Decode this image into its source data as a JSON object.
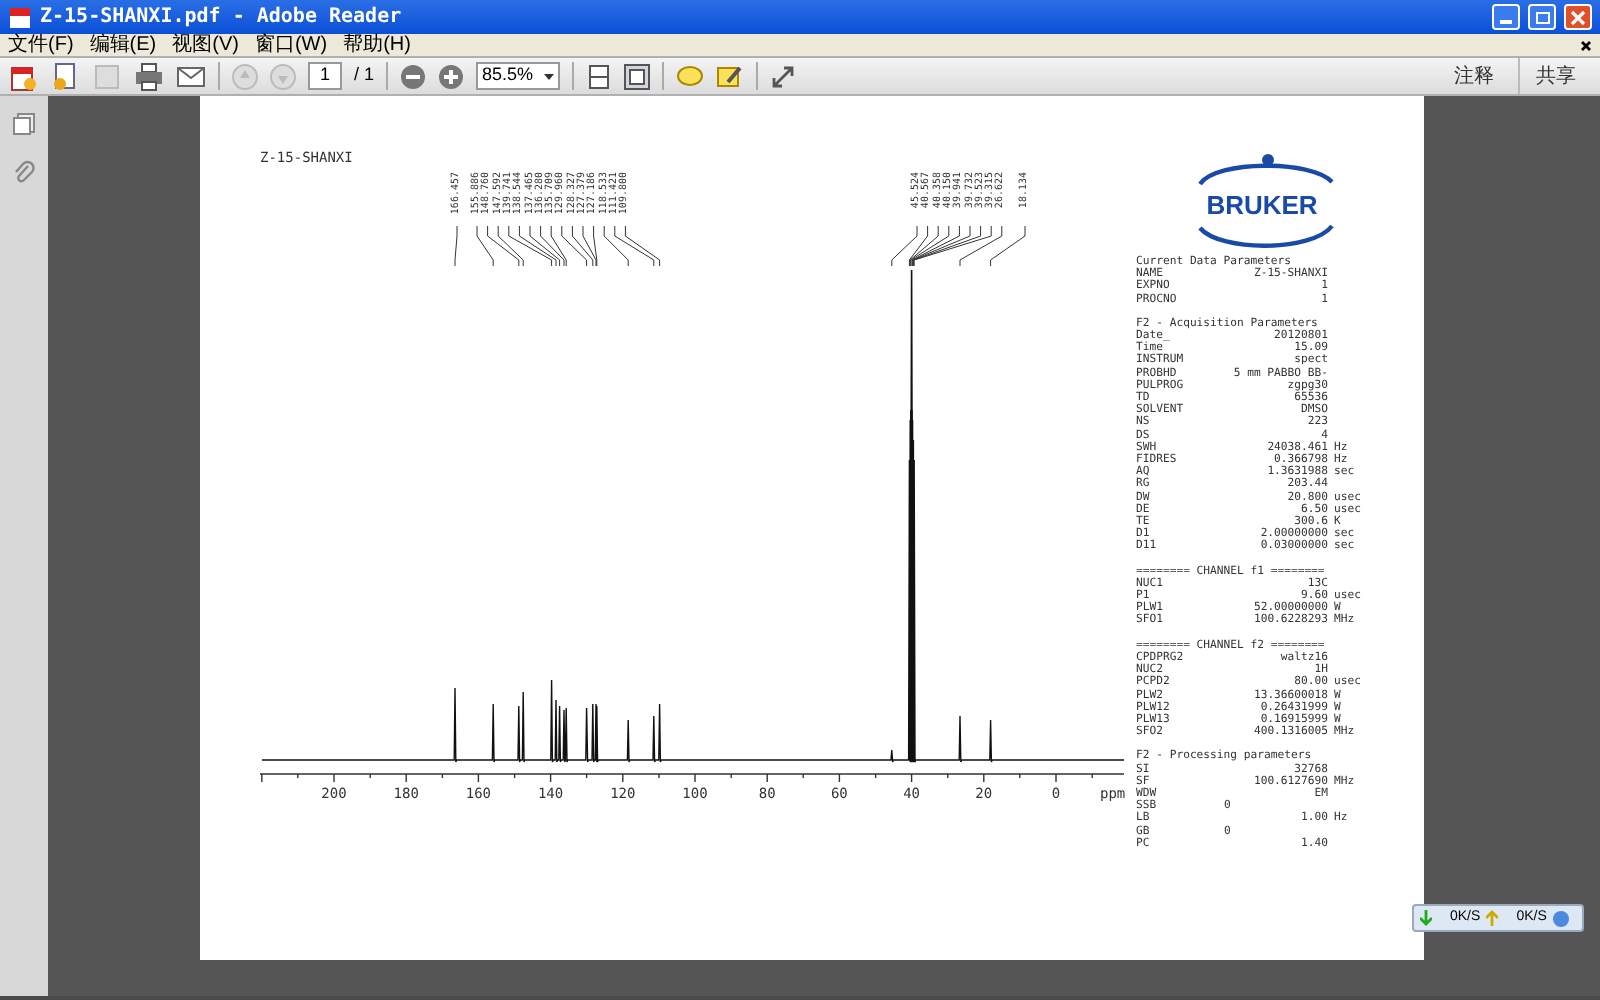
{
  "window": {
    "title": "Z-15-SHANXI.pdf - Adobe Reader"
  },
  "menu": [
    "文件(F)",
    "编辑(E)",
    "视图(V)",
    "窗口(W)",
    "帮助(H)"
  ],
  "toolbar": {
    "page": "1",
    "page_count": "/ 1",
    "zoom": "85.5%",
    "buttons": [
      "注释",
      "共享"
    ]
  },
  "document": {
    "title": "Z-15-SHANXI",
    "peak_labels": [
      "166.457",
      "155.886",
      "148.760",
      "147.592",
      "139.741",
      "138.544",
      "137.465",
      "136.280",
      "135.709",
      "129.960",
      "128.327",
      "127.379",
      "127.186",
      "118.533",
      "111.421",
      "109.800",
      "45.524",
      "40.567",
      "40.358",
      "40.150",
      "39.941",
      "39.732",
      "39.523",
      "39.315",
      "26.622",
      "18.134"
    ],
    "axis": {
      "ticks": [
        "200",
        "180",
        "160",
        "140",
        "120",
        "100",
        "80",
        "60",
        "40",
        "20",
        "0"
      ],
      "unit": "ppm"
    },
    "logo": "BRUKER",
    "parameters": [
      {
        "heading": "Current Data Parameters",
        "rows": [
          {
            "name": "NAME",
            "value": "Z-15-SHANXI"
          },
          {
            "name": "EXPNO",
            "value": "1"
          },
          {
            "name": "PROCNO",
            "value": "1"
          }
        ]
      },
      {
        "heading": "F2 - Acquisition Parameters",
        "rows": [
          {
            "name": "Date_",
            "value": "20120801"
          },
          {
            "name": "Time",
            "value": "15.09"
          },
          {
            "name": "INSTRUM",
            "value": "spect"
          },
          {
            "name": "PROBHD",
            "value": "5 mm PABBO BB-"
          },
          {
            "name": "PULPROG",
            "value": "zgpg30"
          },
          {
            "name": "TD",
            "value": "65536"
          },
          {
            "name": "SOLVENT",
            "value": "DMSO"
          },
          {
            "name": "NS",
            "value": "223"
          },
          {
            "name": "DS",
            "value": "4"
          },
          {
            "name": "SWH",
            "value": "24038.461",
            "unit": "Hz"
          },
          {
            "name": "FIDRES",
            "value": "0.366798",
            "unit": "Hz"
          },
          {
            "name": "AQ",
            "value": "1.3631988",
            "unit": "sec"
          },
          {
            "name": "RG",
            "value": "203.44"
          },
          {
            "name": "DW",
            "value": "20.800",
            "unit": "usec"
          },
          {
            "name": "DE",
            "value": "6.50",
            "unit": "usec"
          },
          {
            "name": "TE",
            "value": "300.6",
            "unit": "K"
          },
          {
            "name": "D1",
            "value": "2.00000000",
            "unit": "sec"
          },
          {
            "name": "D11",
            "value": "0.03000000",
            "unit": "sec"
          }
        ]
      },
      {
        "heading": "======== CHANNEL f1 ========",
        "rows": [
          {
            "name": "NUC1",
            "value": "13C"
          },
          {
            "name": "P1",
            "value": "9.60",
            "unit": "usec"
          },
          {
            "name": "PLW1",
            "value": "52.00000000",
            "unit": "W"
          },
          {
            "name": "SFO1",
            "value": "100.6228293",
            "unit": "MHz"
          }
        ]
      },
      {
        "heading": "======== CHANNEL f2 ========",
        "rows": [
          {
            "name": "CPDPRG2",
            "value": "waltz16"
          },
          {
            "name": "NUC2",
            "value": "1H"
          },
          {
            "name": "PCPD2",
            "value": "80.00",
            "unit": "usec"
          },
          {
            "name": "PLW2",
            "value": "13.36600018",
            "unit": "W"
          },
          {
            "name": "PLW12",
            "value": "0.26431999",
            "unit": "W"
          },
          {
            "name": "PLW13",
            "value": "0.16915999",
            "unit": "W"
          },
          {
            "name": "SFO2",
            "value": "400.1316005",
            "unit": "MHz"
          }
        ]
      },
      {
        "heading": "F2 - Processing parameters",
        "rows": [
          {
            "name": "SI",
            "value": "32768"
          },
          {
            "name": "SF",
            "value": "100.6127690",
            "unit": "MHz"
          },
          {
            "name": "WDW",
            "value": "EM"
          },
          {
            "name": "SSB",
            "value": "0",
            "kind": "short"
          },
          {
            "name": "LB",
            "value": "1.00",
            "unit": "Hz"
          },
          {
            "name": "GB",
            "value": "0",
            "kind": "short"
          },
          {
            "name": "PC",
            "value": "1.40"
          }
        ]
      }
    ]
  },
  "tray": {
    "download": "0K/S",
    "upload": "0K/S"
  }
}
